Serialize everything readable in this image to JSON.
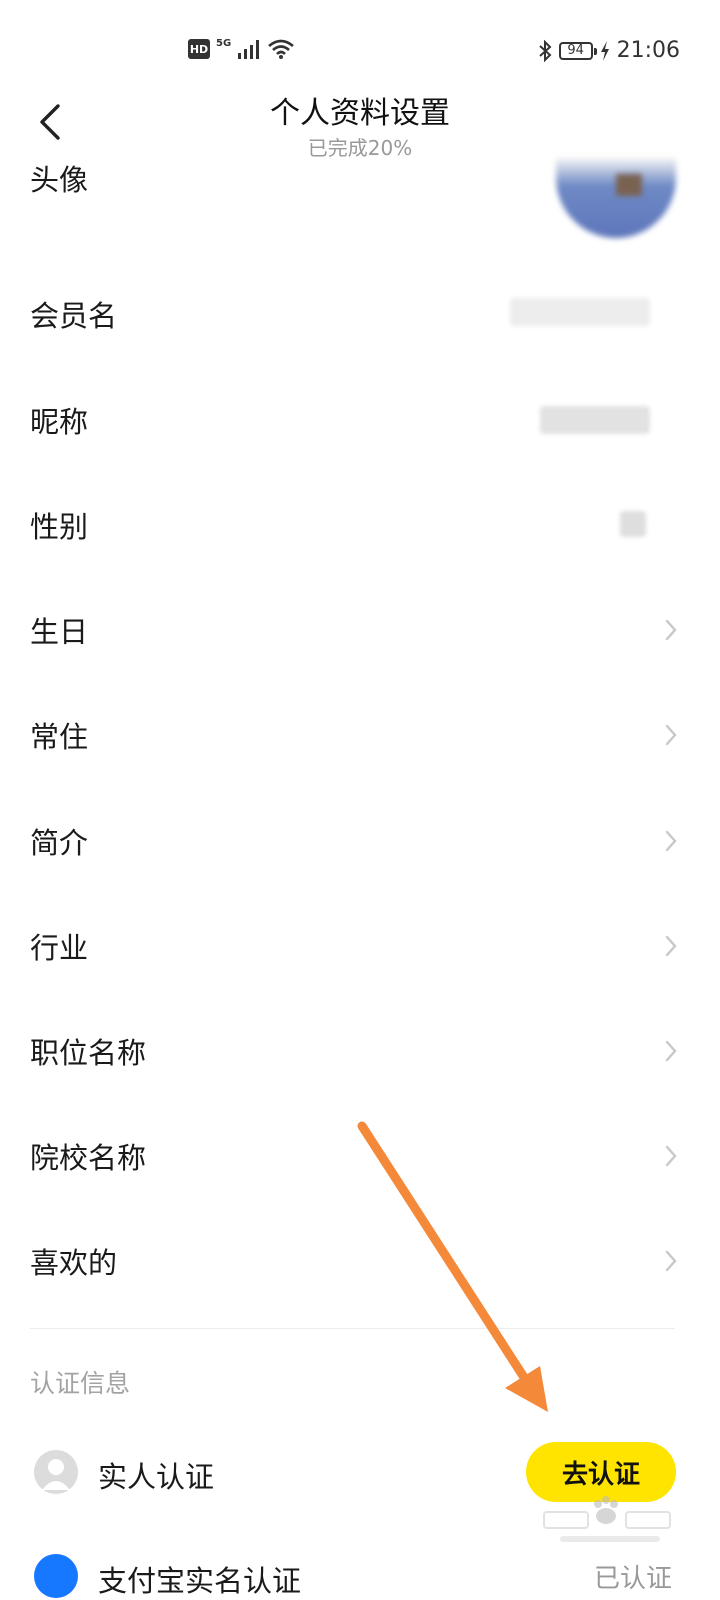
{
  "status_bar": {
    "hd": "HD",
    "network": "5G",
    "battery": "94",
    "time": "21:06"
  },
  "header": {
    "title": "个人资料设置",
    "subtitle": "已完成20%"
  },
  "rows": {
    "avatar": "头像",
    "member_name": "会员名",
    "nickname": "昵称",
    "gender": "性别",
    "birthday": "生日",
    "residence": "常住",
    "bio": "简介",
    "industry": "行业",
    "position": "职位名称",
    "school": "院校名称",
    "likes": "喜欢的"
  },
  "verification": {
    "section_label": "认证信息",
    "real_person_label": "实人认证",
    "verify_button": "去认证",
    "next_label": "支付宝实名认证",
    "next_status": "已认证"
  },
  "colors": {
    "accent_yellow": "#ffe400",
    "annotation_orange": "#f5893a",
    "alipay_blue": "#1677ff"
  }
}
